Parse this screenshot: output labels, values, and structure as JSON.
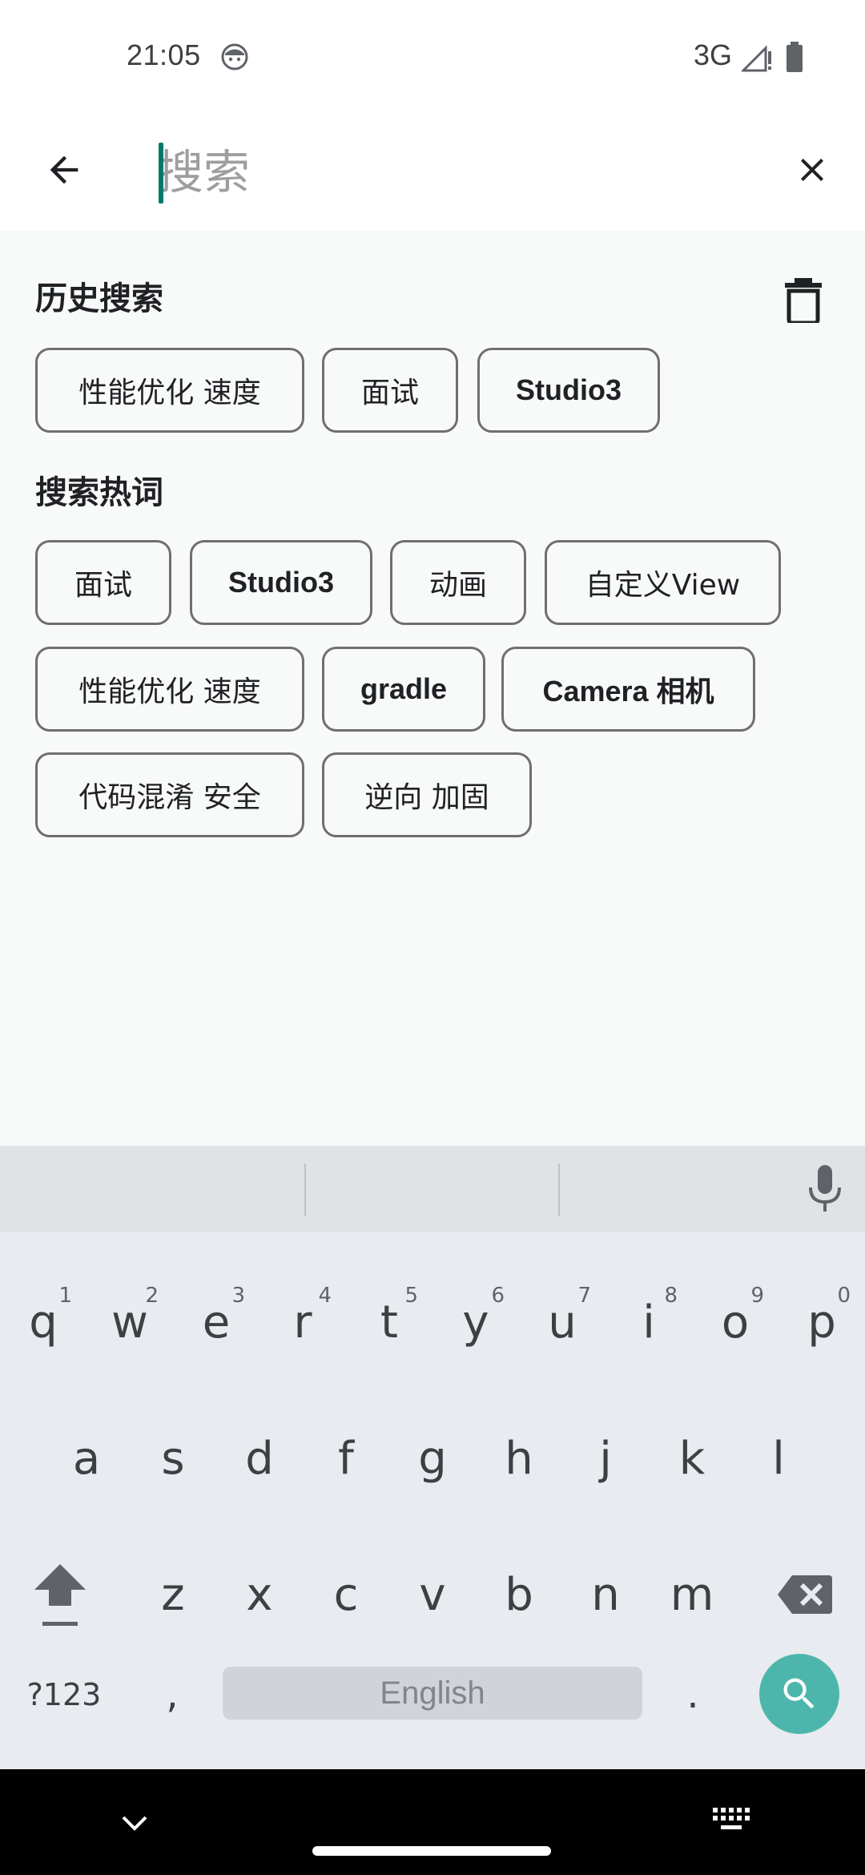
{
  "status_bar": {
    "time": "21:05",
    "network": "3G",
    "icons": [
      "face-icon",
      "signal-icon",
      "battery-icon"
    ]
  },
  "search": {
    "placeholder": "搜索",
    "value": "",
    "back_icon": "arrow-back-icon",
    "clear_icon": "close-icon"
  },
  "history": {
    "title": "历史搜索",
    "delete_icon": "trash-icon",
    "items": [
      "性能优化 速度",
      "面试",
      "Studio3"
    ]
  },
  "hot": {
    "title": "搜索热词",
    "rows": [
      [
        "面试",
        "Studio3",
        "动画",
        "自定义View"
      ],
      [
        "性能优化 速度",
        "gradle",
        "Camera 相机"
      ],
      [
        "代码混淆 安全",
        "逆向 加固"
      ]
    ]
  },
  "keyboard": {
    "row1": [
      {
        "key": "q",
        "hint": "1"
      },
      {
        "key": "w",
        "hint": "2"
      },
      {
        "key": "e",
        "hint": "3"
      },
      {
        "key": "r",
        "hint": "4"
      },
      {
        "key": "t",
        "hint": "5"
      },
      {
        "key": "y",
        "hint": "6"
      },
      {
        "key": "u",
        "hint": "7"
      },
      {
        "key": "i",
        "hint": "8"
      },
      {
        "key": "o",
        "hint": "9"
      },
      {
        "key": "p",
        "hint": "0"
      }
    ],
    "row2": [
      "a",
      "s",
      "d",
      "f",
      "g",
      "h",
      "j",
      "k",
      "l"
    ],
    "row3": [
      "z",
      "x",
      "c",
      "v",
      "b",
      "n",
      "m"
    ],
    "symbols_label": "?123",
    "comma": ",",
    "space_label": "English",
    "period": ".",
    "accent_color": "#4db6ac"
  },
  "colors": {
    "caret": "#00796b",
    "chip_border": "#6f6f6f",
    "content_bg": "#f8f9f9"
  }
}
